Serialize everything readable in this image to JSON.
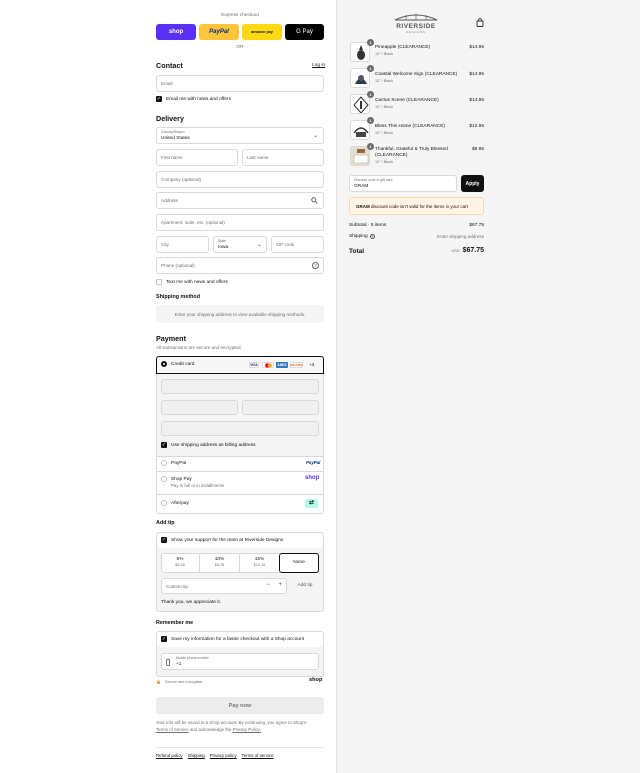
{
  "express": {
    "title": "Express checkout",
    "or": "OR",
    "shop_pay": "shop",
    "paypal": "PayPal",
    "amazon": "amazon pay",
    "gpay": "G Pay"
  },
  "contact": {
    "heading": "Contact",
    "login": "Log in",
    "email_placeholder": "Email",
    "email_opt_in": "Email me with news and offers"
  },
  "delivery": {
    "heading": "Delivery",
    "country_label": "Country/Region",
    "country_value": "United States",
    "first_name": "First name",
    "last_name": "Last name",
    "company": "Company (optional)",
    "address": "Address",
    "apartment": "Apartment, suite, etc. (optional)",
    "city": "City",
    "state_label": "State",
    "state_value": "Iowa",
    "zip": "ZIP code",
    "phone": "Phone (optional)",
    "text_opt_in": "Text me with news and offers"
  },
  "shipping": {
    "heading": "Shipping method",
    "notice": "Enter your shipping address to view available shipping methods."
  },
  "payment": {
    "heading": "Payment",
    "subtitle": "All transactions are secure and encrypted.",
    "credit_card": "Credit card",
    "more_cards": "+4",
    "card_brands": [
      "VISA",
      "MC",
      "AMEX",
      "DISCOVER"
    ],
    "billing_same": "Use shipping address as billing address",
    "paypal": "PayPal",
    "paypal_logo": "PayPal",
    "shop_pay": "Shop Pay",
    "shop_pay_sub": "Pay in full or in installments",
    "shop_logo": "shop",
    "afterpay": "Afterpay"
  },
  "tip": {
    "heading": "Add tip",
    "support": "Show your support for the team at Riverside Designs",
    "options": [
      {
        "pct": "5%",
        "amt": "$3.39"
      },
      {
        "pct": "10%",
        "amt": "$6.78"
      },
      {
        "pct": "15%",
        "amt": "$10.16"
      },
      {
        "pct": "None",
        "amt": ""
      }
    ],
    "custom": "Custom tip",
    "minus": "−",
    "plus": "+",
    "add": "Add tip",
    "thanks": "Thank you, we appreciate it."
  },
  "remember": {
    "heading": "Remember me",
    "save": "Save my information for a faster checkout with a Shop account",
    "mobile_label": "Mobile phone number",
    "mobile_value": "+1",
    "secure": "Secure and encrypted",
    "shop": "shop"
  },
  "pay_now": "Pay now",
  "legal": {
    "text1": "Your info will be saved to a Shop account. By continuing, you agree to Shop's",
    "terms": "Terms of Service",
    "text2": "and acknowledge the",
    "privacy": "Privacy Policy."
  },
  "footer": [
    "Refund policy",
    "Shipping",
    "Privacy policy",
    "Terms of service"
  ],
  "brand": {
    "name": "RIVERSIDE",
    "sub": "DESIGNS"
  },
  "cart": [
    {
      "qty": "1",
      "name": "Pineapple (CLEARANCE)",
      "variant": "12\" / Black",
      "price": "$14.95"
    },
    {
      "qty": "1",
      "name": "Coastal Welcome Sign (CLEARANCE)",
      "variant": "12\" / Black",
      "price": "$14.95"
    },
    {
      "qty": "1",
      "name": "Cactus Scene (CLEARANCE)",
      "variant": "12\" / Black",
      "price": "$14.95"
    },
    {
      "qty": "1",
      "name": "Bless This Home (CLEARANCE)",
      "variant": "12\" / Black",
      "price": "$12.95"
    },
    {
      "qty": "1",
      "name": "Thankful, Grateful & Truly Blessed (CLEARANCE)",
      "variant": "12\" / Black",
      "price": "$9.95"
    }
  ],
  "discount": {
    "label": "Discount code or gift card",
    "value": "GRAM",
    "apply": "Apply",
    "error_code": "GRAM",
    "error_text": "discount code isn't valid for the items in your cart"
  },
  "summary": {
    "subtotal_label": "Subtotal · 5 items",
    "subtotal": "$67.75",
    "shipping_label": "Shipping",
    "shipping_value": "Enter shipping address",
    "total_label": "Total",
    "currency": "USD",
    "total": "$67.75"
  }
}
